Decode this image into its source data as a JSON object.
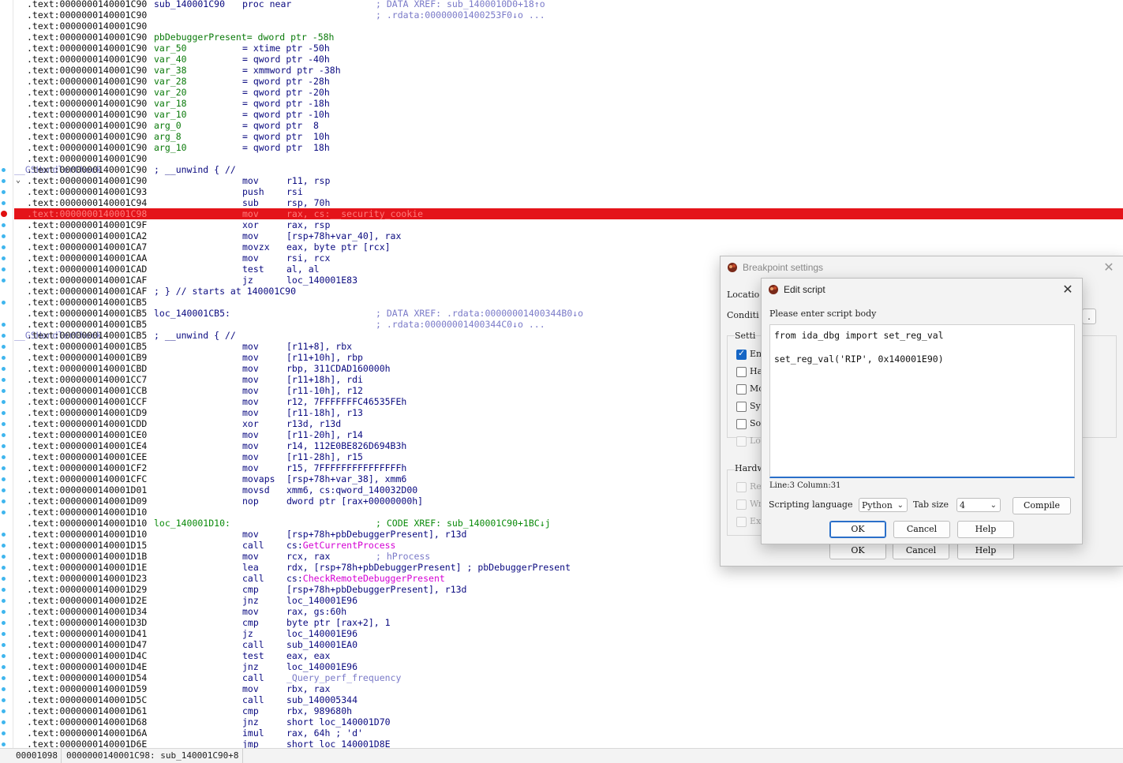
{
  "listing": [
    {
      "addr": ".text:0000000140001C90",
      "label": "sub_140001C90",
      "mn": "proc near",
      "op": "",
      "cmt": "; DATA XREF: sub_1400010D0+18↑o"
    },
    {
      "addr": ".text:0000000140001C90",
      "label": "",
      "mn": "",
      "op": "",
      "cmt": "; .rdata:00000001400253F0↓o ..."
    },
    {
      "addr": ".text:0000000140001C90",
      "label": "",
      "mn": "",
      "op": "",
      "cmt": ""
    },
    {
      "addr": ".text:0000000140001C90",
      "label": "pbDebuggerPresent= dword ptr -58h",
      "mn": "",
      "op": "",
      "cmt": "",
      "var": true
    },
    {
      "addr": ".text:0000000140001C90",
      "label": "var_50",
      "mn": "= xtime ptr -50h",
      "op": "",
      "cmt": "",
      "var": true
    },
    {
      "addr": ".text:0000000140001C90",
      "label": "var_40",
      "mn": "= qword ptr -40h",
      "op": "",
      "cmt": "",
      "var": true
    },
    {
      "addr": ".text:0000000140001C90",
      "label": "var_38",
      "mn": "= xmmword ptr -38h",
      "op": "",
      "cmt": "",
      "var": true
    },
    {
      "addr": ".text:0000000140001C90",
      "label": "var_28",
      "mn": "= qword ptr -28h",
      "op": "",
      "cmt": "",
      "var": true
    },
    {
      "addr": ".text:0000000140001C90",
      "label": "var_20",
      "mn": "= qword ptr -20h",
      "op": "",
      "cmt": "",
      "var": true
    },
    {
      "addr": ".text:0000000140001C90",
      "label": "var_18",
      "mn": "= qword ptr -18h",
      "op": "",
      "cmt": "",
      "var": true
    },
    {
      "addr": ".text:0000000140001C90",
      "label": "var_10",
      "mn": "= qword ptr -10h",
      "op": "",
      "cmt": "",
      "var": true
    },
    {
      "addr": ".text:0000000140001C90",
      "label": "arg_0",
      "mn": "= qword ptr  8",
      "op": "",
      "cmt": "",
      "var": true
    },
    {
      "addr": ".text:0000000140001C90",
      "label": "arg_8",
      "mn": "= qword ptr  10h",
      "op": "",
      "cmt": "",
      "var": true
    },
    {
      "addr": ".text:0000000140001C90",
      "label": "arg_10",
      "mn": "= qword ptr  18h",
      "op": "",
      "cmt": "",
      "var": true
    },
    {
      "addr": ".text:0000000140001C90",
      "label": "",
      "mn": "",
      "op": "",
      "cmt": ""
    },
    {
      "addr": ".text:0000000140001C90",
      "label": "; __unwind { // ",
      "mn": "",
      "op": "",
      "cmt": "",
      "unwind": "__GSHandlerCheck"
    },
    {
      "addr": ".text:0000000140001C90",
      "label": "",
      "mn": "mov",
      "op": "r11, rsp",
      "cmt": "",
      "arrow": true
    },
    {
      "addr": ".text:0000000140001C93",
      "label": "",
      "mn": "push",
      "op": "rsi",
      "cmt": ""
    },
    {
      "addr": ".text:0000000140001C94",
      "label": "",
      "mn": "sub",
      "op": "rsp, 70h",
      "cmt": ""
    },
    {
      "addr": ".text:0000000140001C98",
      "label": "",
      "mn": "mov",
      "op": "rax, cs:__security_cookie",
      "cmt": "",
      "current": true
    },
    {
      "addr": ".text:0000000140001C9F",
      "label": "",
      "mn": "xor",
      "op": "rax, rsp",
      "cmt": ""
    },
    {
      "addr": ".text:0000000140001CA2",
      "label": "",
      "mn": "mov",
      "op": "[rsp+78h+var_40], rax",
      "cmt": ""
    },
    {
      "addr": ".text:0000000140001CA7",
      "label": "",
      "mn": "movzx",
      "op": "eax, byte ptr [rcx]",
      "cmt": ""
    },
    {
      "addr": ".text:0000000140001CAA",
      "label": "",
      "mn": "mov",
      "op": "rsi, rcx",
      "cmt": ""
    },
    {
      "addr": ".text:0000000140001CAD",
      "label": "",
      "mn": "test",
      "op": "al, al",
      "cmt": ""
    },
    {
      "addr": ".text:0000000140001CAF",
      "label": "",
      "mn": "jz",
      "op": "loc_140001E83",
      "cmt": ""
    },
    {
      "addr": ".text:0000000140001CAF",
      "label": "; } // starts at 140001C90",
      "mn": "",
      "op": "",
      "cmt": ""
    },
    {
      "addr": ".text:0000000140001CB5",
      "label": "",
      "mn": "",
      "op": "",
      "cmt": ""
    },
    {
      "addr": ".text:0000000140001CB5",
      "label": "loc_140001CB5:",
      "mn": "",
      "op": "",
      "cmt": "; DATA XREF: .rdata:00000001400344B0↓o"
    },
    {
      "addr": ".text:0000000140001CB5",
      "label": "",
      "mn": "",
      "op": "",
      "cmt": "; .rdata:00000001400344C0↓o ..."
    },
    {
      "addr": ".text:0000000140001CB5",
      "label": "; __unwind { // ",
      "mn": "",
      "op": "",
      "cmt": "",
      "unwind": "__GSHandlerCheck"
    },
    {
      "addr": ".text:0000000140001CB5",
      "label": "",
      "mn": "mov",
      "op": "[r11+8], rbx",
      "cmt": ""
    },
    {
      "addr": ".text:0000000140001CB9",
      "label": "",
      "mn": "mov",
      "op": "[r11+10h], rbp",
      "cmt": ""
    },
    {
      "addr": ".text:0000000140001CBD",
      "label": "",
      "mn": "mov",
      "op": "rbp, 311CDAD160000h",
      "cmt": ""
    },
    {
      "addr": ".text:0000000140001CC7",
      "label": "",
      "mn": "mov",
      "op": "[r11+18h], rdi",
      "cmt": ""
    },
    {
      "addr": ".text:0000000140001CCB",
      "label": "",
      "mn": "mov",
      "op": "[r11-10h], r12",
      "cmt": ""
    },
    {
      "addr": ".text:0000000140001CCF",
      "label": "",
      "mn": "mov",
      "op": "r12, 7FFFFFFFC46535FEh",
      "cmt": ""
    },
    {
      "addr": ".text:0000000140001CD9",
      "label": "",
      "mn": "mov",
      "op": "[r11-18h], r13",
      "cmt": ""
    },
    {
      "addr": ".text:0000000140001CDD",
      "label": "",
      "mn": "xor",
      "op": "r13d, r13d",
      "cmt": ""
    },
    {
      "addr": ".text:0000000140001CE0",
      "label": "",
      "mn": "mov",
      "op": "[r11-20h], r14",
      "cmt": ""
    },
    {
      "addr": ".text:0000000140001CE4",
      "label": "",
      "mn": "mov",
      "op": "r14, 112E0BE826D694B3h",
      "cmt": ""
    },
    {
      "addr": ".text:0000000140001CEE",
      "label": "",
      "mn": "mov",
      "op": "[r11-28h], r15",
      "cmt": ""
    },
    {
      "addr": ".text:0000000140001CF2",
      "label": "",
      "mn": "mov",
      "op": "r15, 7FFFFFFFFFFFFFFFh",
      "cmt": ""
    },
    {
      "addr": ".text:0000000140001CFC",
      "label": "",
      "mn": "movaps",
      "op": "[rsp+78h+var_38], xmm6",
      "cmt": ""
    },
    {
      "addr": ".text:0000000140001D01",
      "label": "",
      "mn": "movsd",
      "op": "xmm6, cs:qword_140032D00",
      "cmt": ""
    },
    {
      "addr": ".text:0000000140001D09",
      "label": "",
      "mn": "nop",
      "op": "dword ptr [rax+00000000h]",
      "cmt": ""
    },
    {
      "addr": ".text:0000000140001D10",
      "label": "",
      "mn": "",
      "op": "",
      "cmt": ""
    },
    {
      "addr": ".text:0000000140001D10",
      "label": "loc_140001D10:",
      "mn": "",
      "op": "",
      "cmt": "; CODE XREF: sub_140001C90+1BC↓j",
      "green": true
    },
    {
      "addr": ".text:0000000140001D10",
      "label": "",
      "mn": "mov",
      "op": "[rsp+78h+pbDebuggerPresent], r13d",
      "cmt": ""
    },
    {
      "addr": ".text:0000000140001D15",
      "label": "",
      "mn": "call",
      "op": "cs:",
      "fn": "GetCurrentProcess",
      "cmt": ""
    },
    {
      "addr": ".text:0000000140001D1B",
      "label": "",
      "mn": "mov",
      "op": "rcx, rax",
      "cmt": "; hProcess"
    },
    {
      "addr": ".text:0000000140001D1E",
      "label": "",
      "mn": "lea",
      "op": "rdx, [rsp+78h+pbDebuggerPresent] ; pbDebuggerPresent",
      "cmt": ""
    },
    {
      "addr": ".text:0000000140001D23",
      "label": "",
      "mn": "call",
      "op": "cs:",
      "fn": "CheckRemoteDebuggerPresent",
      "cmt": ""
    },
    {
      "addr": ".text:0000000140001D29",
      "label": "",
      "mn": "cmp",
      "op": "[rsp+78h+pbDebuggerPresent], r13d",
      "cmt": ""
    },
    {
      "addr": ".text:0000000140001D2E",
      "label": "",
      "mn": "jnz",
      "op": "loc_140001E96",
      "cmt": ""
    },
    {
      "addr": ".text:0000000140001D34",
      "label": "",
      "mn": "mov",
      "op": "rax, gs:60h",
      "cmt": ""
    },
    {
      "addr": ".text:0000000140001D3D",
      "label": "",
      "mn": "cmp",
      "op": "byte ptr [rax+2], 1",
      "cmt": ""
    },
    {
      "addr": ".text:0000000140001D41",
      "label": "",
      "mn": "jz",
      "op": "loc_140001E96",
      "cmt": ""
    },
    {
      "addr": ".text:0000000140001D47",
      "label": "",
      "mn": "call",
      "op": "sub_140001EA0",
      "cmt": ""
    },
    {
      "addr": ".text:0000000140001D4C",
      "label": "",
      "mn": "test",
      "op": "eax, eax",
      "cmt": ""
    },
    {
      "addr": ".text:0000000140001D4E",
      "label": "",
      "mn": "jnz",
      "op": "loc_140001E96",
      "cmt": ""
    },
    {
      "addr": ".text:0000000140001D54",
      "label": "",
      "mn": "call",
      "op": "",
      "fn2": "_Query_perf_frequency",
      "cmt": ""
    },
    {
      "addr": ".text:0000000140001D59",
      "label": "",
      "mn": "mov",
      "op": "rbx, rax",
      "cmt": ""
    },
    {
      "addr": ".text:0000000140001D5C",
      "label": "",
      "mn": "call",
      "op": "sub_140005344",
      "cmt": ""
    },
    {
      "addr": ".text:0000000140001D61",
      "label": "",
      "mn": "cmp",
      "op": "rbx, 989680h",
      "cmt": ""
    },
    {
      "addr": ".text:0000000140001D68",
      "label": "",
      "mn": "jnz",
      "op": "short loc_140001D70",
      "cmt": ""
    },
    {
      "addr": ".text:0000000140001D6A",
      "label": "",
      "mn": "imul",
      "op": "rax, 64h ; 'd'",
      "cmt": ""
    },
    {
      "addr": ".text:0000000140001D6E",
      "label": "",
      "mn": "jmp",
      "op": "short loc_140001D8E",
      "cmt": ""
    }
  ],
  "statusbar": {
    "offset": "00001098",
    "location": "0000000140001C98: sub_140001C90+8"
  },
  "bp_dialog": {
    "title": "Breakpoint settings",
    "location_label": "Locatio",
    "condition_label": "Conditi",
    "settings_label": "Setti",
    "hardware_label": "Hardw",
    "checkboxes": [
      "Ena",
      "Har",
      "Mod",
      "Sym",
      "Sou",
      "Lov"
    ],
    "hw_checkboxes": [
      "Rea",
      "Wri",
      "Exe"
    ],
    "ok": "OK",
    "cancel": "Cancel",
    "help": "Help"
  },
  "script_dialog": {
    "title": "Edit script",
    "prompt": "Please enter script body",
    "code": [
      "from ida_dbg import set_reg_val",
      "",
      "set_reg_val('RIP', 0x140001E90)"
    ],
    "cursor": "Line:3  Column:31",
    "lang_label": "Scripting language",
    "lang_value": "Python",
    "tab_label": "Tab size",
    "tab_value": "4",
    "compile": "Compile",
    "ok": "OK",
    "cancel": "Cancel",
    "help": "Help"
  },
  "colors": {
    "current_line": "#e4141a",
    "breakpoint": "#3fb6ee",
    "accent": "#2a6fc9"
  }
}
